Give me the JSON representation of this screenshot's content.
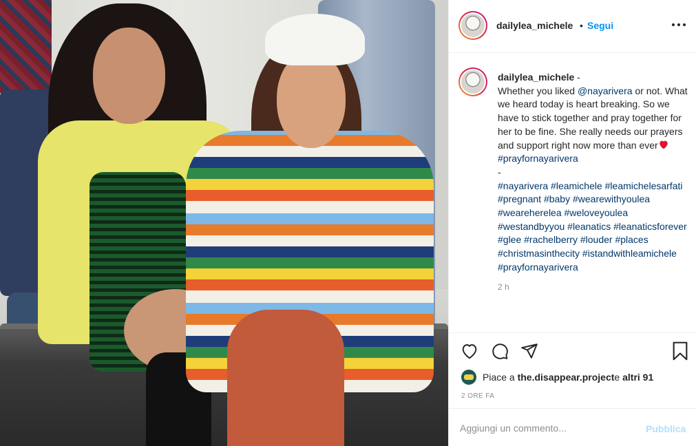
{
  "post": {
    "username": "dailylea_michele",
    "separator": "•",
    "follow_label": "Segui",
    "caption": {
      "username": "dailylea_michele",
      "dash": " -",
      "line1_pre": "Whether you liked ",
      "mention": "@nayarivera",
      "line1_post": " or not. What we heard today is heart breaking. So we have to stick together and pray together for her to be fine. She really needs our prayers and support right now more than ever",
      "tag_prayfor": "#prayfornayarivera",
      "dash_line": "-",
      "hashtags": "#nayarivera #leamichele #leamichelesarfati #pregnant #baby #wearewithyoulea #weareherelea #weloveyoulea #westandbyyou #leanatics #leanaticsforever #glee #rachelberry #louder #places #christmasinthecity #istandwithleamichele #prayfornayarivera",
      "time": "2 h"
    },
    "likes": {
      "prefix": "Piace a ",
      "user": "the.disappear.project",
      "middle": " e ",
      "others": "altri 91"
    },
    "date": "2 ORE FA",
    "comment": {
      "placeholder": "Aggiungi un commento...",
      "publish_label": "Pubblica"
    }
  },
  "icons": {
    "like": "heart-icon",
    "comment": "comment-bubble-icon",
    "share": "paper-plane-icon",
    "save": "bookmark-icon",
    "more": "more-options-icon",
    "caption_heart": "red-heart-emoji"
  },
  "colors": {
    "link_blue": "#0095f6",
    "hashtag": "#00376b",
    "muted": "#8e8e8e",
    "publish_disabled": "#b2dffc"
  }
}
